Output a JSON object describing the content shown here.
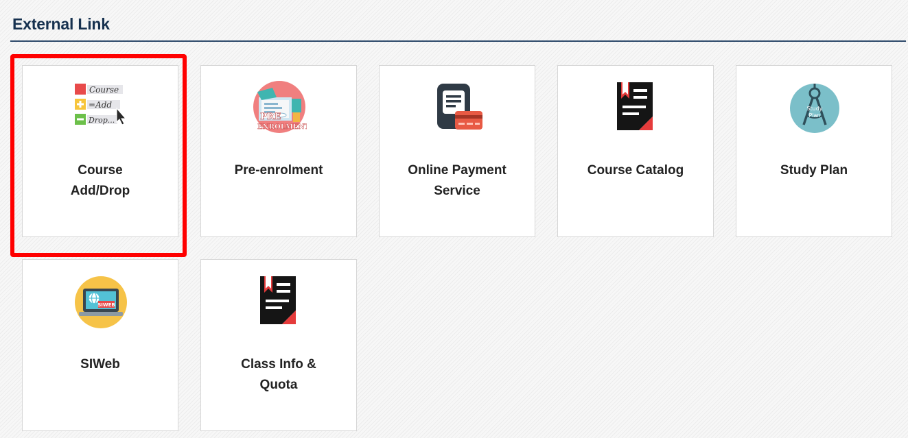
{
  "section": {
    "title": "External Link"
  },
  "tiles": [
    {
      "label": "Course\nAdd/Drop",
      "icon": "course-add-drop-icon"
    },
    {
      "label": "Pre-enrolment",
      "icon": "pre-enrolment-icon"
    },
    {
      "label": "Online Payment\nService",
      "icon": "online-payment-icon"
    },
    {
      "label": "Course Catalog",
      "icon": "course-catalog-icon"
    },
    {
      "label": "Study Plan",
      "icon": "study-plan-icon"
    },
    {
      "label": "SIWeb",
      "icon": "siweb-icon"
    },
    {
      "label": "Class Info &\nQuota",
      "icon": "class-info-icon"
    }
  ],
  "icon_text": {
    "course_add_drop": [
      "Course",
      "=Add",
      "Drop..."
    ],
    "pre_enrolment": [
      "PRE",
      "ENROLMENT"
    ],
    "study_plan": [
      "Study",
      "Plan"
    ],
    "siweb": "SIWEB"
  },
  "colors": {
    "title": "#16314f",
    "divider": "#2e4a6b",
    "highlight": "#ff0000"
  }
}
